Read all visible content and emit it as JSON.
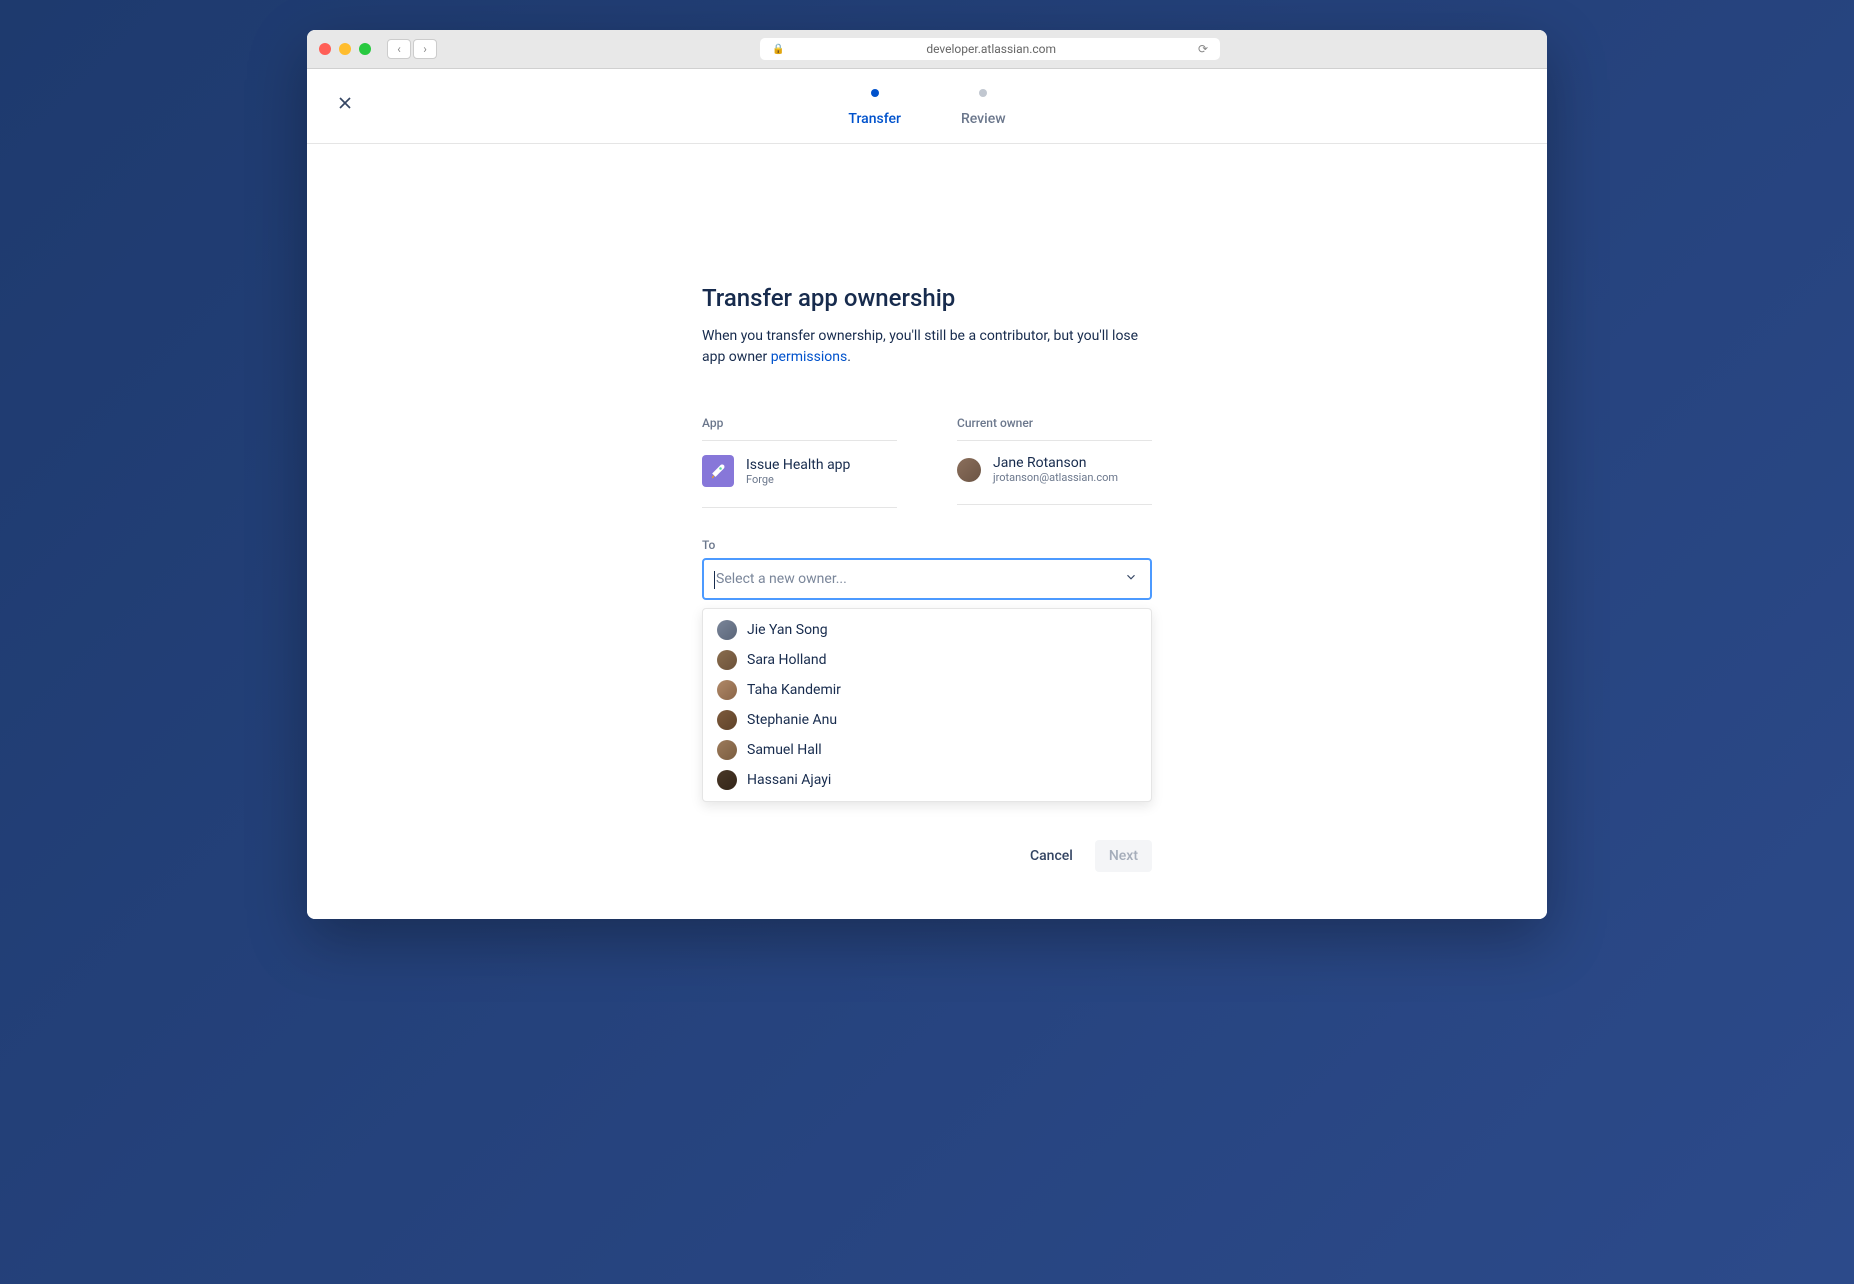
{
  "browser": {
    "url": "developer.atlassian.com"
  },
  "stepper": {
    "steps": [
      {
        "label": "Transfer",
        "active": true
      },
      {
        "label": "Review",
        "active": false
      }
    ]
  },
  "page": {
    "title": "Transfer app ownership",
    "description_before": "When you transfer ownership, you'll still be a contributor, but you'll lose app owner ",
    "description_link": "permissions",
    "description_after": "."
  },
  "app_section": {
    "label": "App",
    "name": "Issue Health app",
    "platform": "Forge"
  },
  "owner_section": {
    "label": "Current owner",
    "name": "Jane Rotanson",
    "email": "jrotanson@atlassian.com"
  },
  "to_section": {
    "label": "To",
    "placeholder": "Select a new owner..."
  },
  "dropdown_options": [
    {
      "name": "Jie Yan Song",
      "avatar_class": "av-1"
    },
    {
      "name": "Sara Holland",
      "avatar_class": "av-2"
    },
    {
      "name": "Taha Kandemir",
      "avatar_class": "av-3"
    },
    {
      "name": "Stephanie Anu",
      "avatar_class": "av-4"
    },
    {
      "name": "Samuel Hall",
      "avatar_class": "av-5"
    },
    {
      "name": "Hassani Ajayi",
      "avatar_class": "av-6"
    }
  ],
  "actions": {
    "cancel": "Cancel",
    "next": "Next"
  }
}
